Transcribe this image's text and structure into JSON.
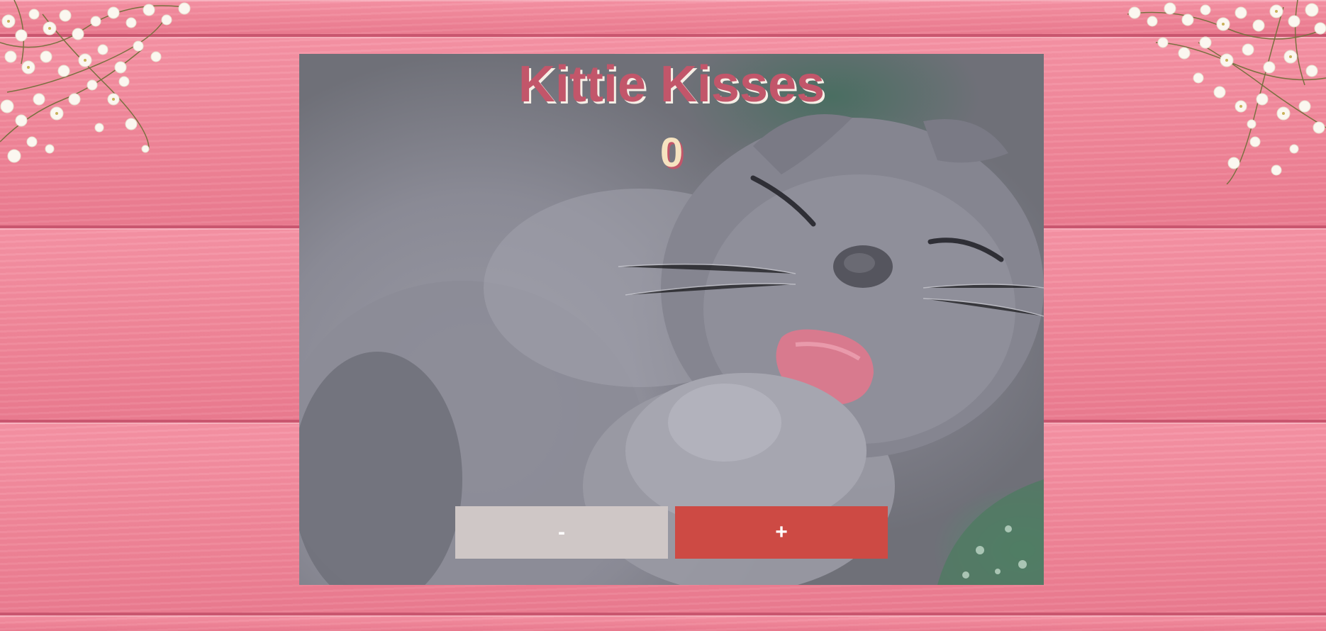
{
  "app": {
    "title": "Kittie Kisses",
    "count": "0"
  },
  "controls": {
    "decrement_label": "-",
    "increment_label": "+"
  },
  "colors": {
    "background": "#ee8a9c",
    "title": "#c2566a",
    "counter": "#f6e3c0",
    "decrement_button": "#cfc7c6",
    "increment_button": "#cd4a44"
  },
  "images": {
    "background": "pink-wood-planks",
    "decoration": "babys-breath-flowers-icon",
    "main": "grey-kitten-licking-paw"
  }
}
